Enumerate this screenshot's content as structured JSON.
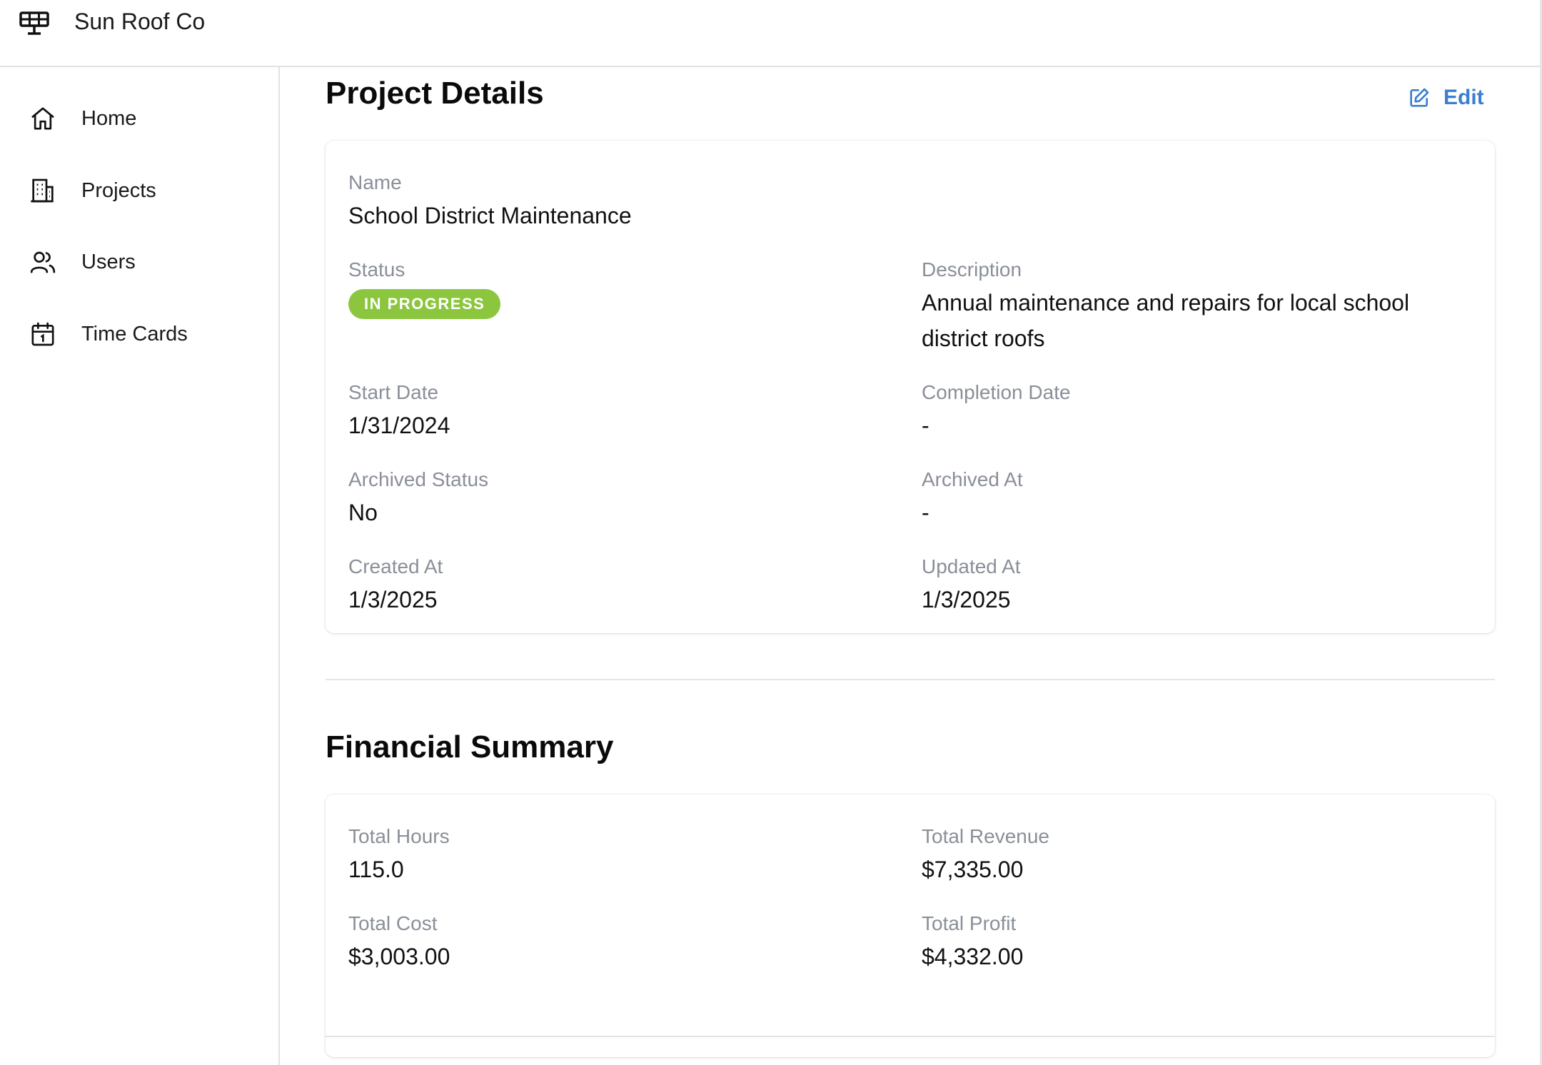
{
  "app": {
    "brand_name": "Sun Roof Co",
    "brand_icon": "solar-panel-icon"
  },
  "sidebar": {
    "items": [
      {
        "label": "Home",
        "icon": "home-icon"
      },
      {
        "label": "Projects",
        "icon": "building-icon"
      },
      {
        "label": "Users",
        "icon": "users-icon"
      },
      {
        "label": "Time Cards",
        "icon": "calendar-icon"
      }
    ]
  },
  "project_details": {
    "title": "Project Details",
    "edit_label": "Edit",
    "fields": {
      "name": {
        "label": "Name",
        "value": "School District Maintenance"
      },
      "status": {
        "label": "Status",
        "value": "IN PROGRESS",
        "color": "#8cc63f"
      },
      "description": {
        "label": "Description",
        "value": "Annual maintenance and repairs for local school district roofs"
      },
      "start_date": {
        "label": "Start Date",
        "value": "1/31/2024"
      },
      "completion_date": {
        "label": "Completion Date",
        "value": "-"
      },
      "archived_status": {
        "label": "Archived Status",
        "value": "No"
      },
      "archived_at": {
        "label": "Archived At",
        "value": "-"
      },
      "created_at": {
        "label": "Created At",
        "value": "1/3/2025"
      },
      "updated_at": {
        "label": "Updated At",
        "value": "1/3/2025"
      }
    }
  },
  "financial_summary": {
    "title": "Financial Summary",
    "fields": {
      "total_hours": {
        "label": "Total Hours",
        "value": "115.0"
      },
      "total_revenue": {
        "label": "Total Revenue",
        "value": "$7,335.00"
      },
      "total_cost": {
        "label": "Total Cost",
        "value": "$3,003.00"
      },
      "total_profit": {
        "label": "Total Profit",
        "value": "$4,332.00"
      }
    }
  },
  "colors": {
    "accent": "#3b7fd1",
    "status_in_progress": "#8cc63f",
    "label_gray": "#8a8f98"
  }
}
